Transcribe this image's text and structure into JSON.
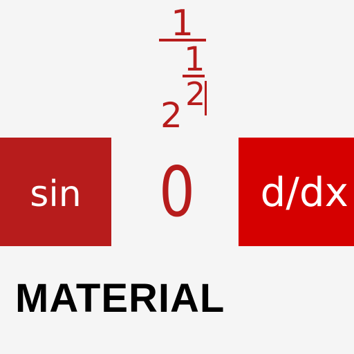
{
  "expression": {
    "outer_numerator": "1",
    "inner_numerator": "1",
    "inner_denominator": "2",
    "base": "2"
  },
  "keys": {
    "sin_label": "sin",
    "derivative_label": "d/dx"
  },
  "result": "0",
  "brand": "MATERIAL",
  "colors": {
    "background": "#f5f5f5",
    "accent": "#b71c1c",
    "sin_key": "#b71c1c",
    "derivative_key": "#d50000",
    "brand_text": "#000000"
  }
}
